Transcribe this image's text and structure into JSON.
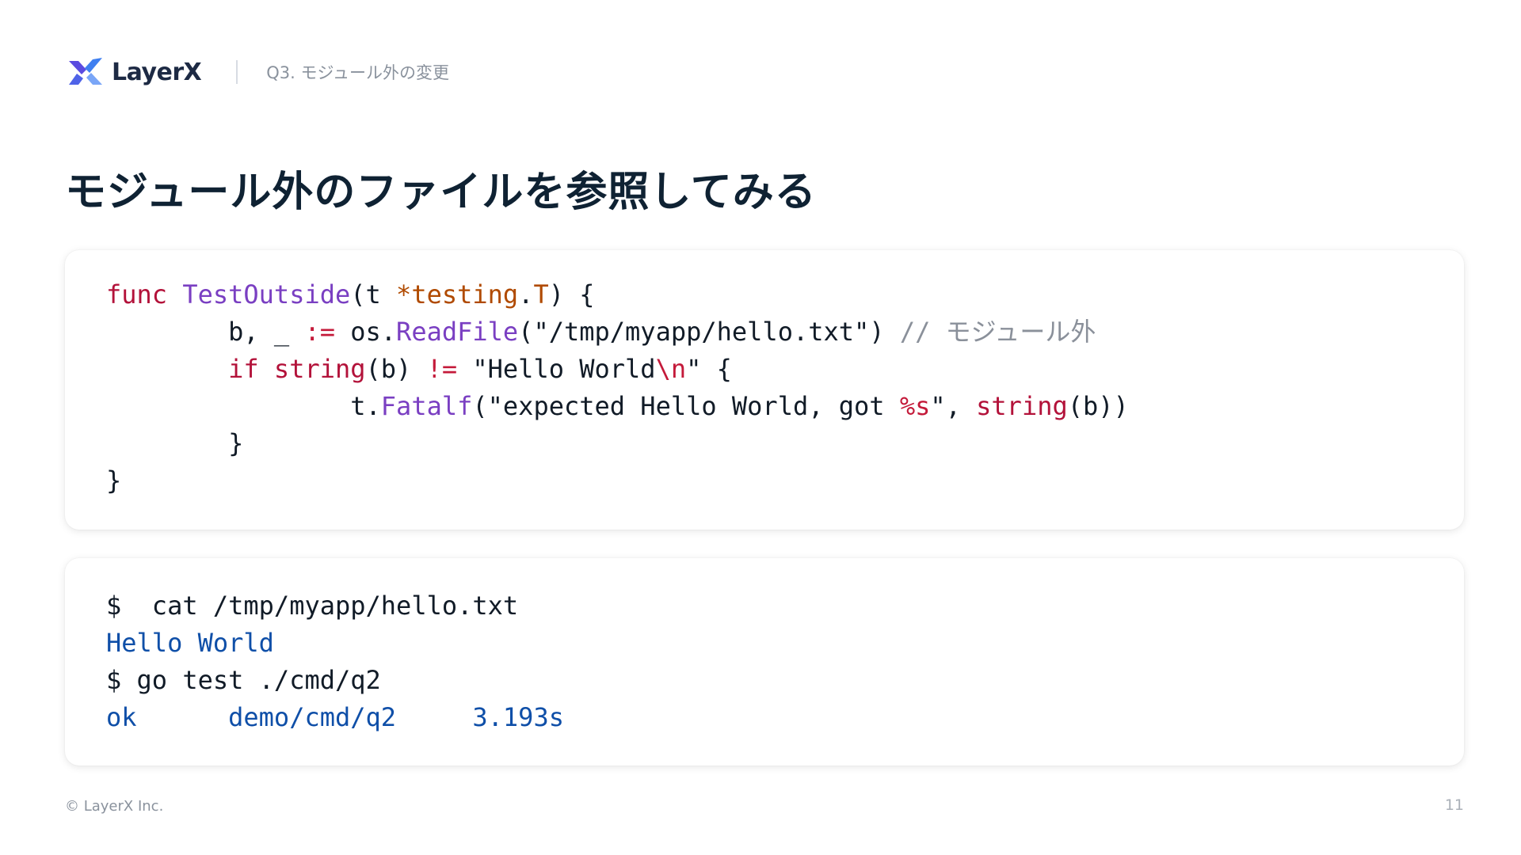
{
  "header": {
    "logo_text": "LayerX",
    "section": "Q3. モジュール外の変更"
  },
  "title": "モジュール外のファイルを参照してみる",
  "code": {
    "line1": {
      "kw": "func",
      "fn": "TestOutside",
      "open": "(t ",
      "ptr": "*testing",
      "dot": ".",
      "ty": "T",
      "close": ") {"
    },
    "line2": {
      "pre": "        b, _ ",
      "op": ":=",
      "mid": " os.",
      "fn": "ReadFile",
      "args": "(\"/tmp/myapp/hello.txt\") ",
      "cm": "// モジュール外"
    },
    "line3": {
      "kw": "if",
      "sp": " ",
      "fn": "string",
      "arg": "(b) ",
      "op": "!=",
      "str": " \"Hello World",
      "esc": "\\n",
      "tail": "\" {"
    },
    "line4": {
      "pre": "                t.",
      "fn": "Fatalf",
      "str": "(\"expected Hello World, got ",
      "fmt": "%s",
      "mid": "\", ",
      "fn2": "string",
      "tail": "(b))"
    },
    "line5": "        }",
    "line6": "}"
  },
  "terminal": {
    "line1": "$  cat /tmp/myapp/hello.txt",
    "line2": "Hello World",
    "line3": "$ go test ./cmd/q2",
    "line4": "ok      demo/cmd/q2     3.193s"
  },
  "footer": {
    "copyright": "© LayerX Inc.",
    "page_number": "11"
  },
  "colors": {
    "keyword": "#b3123a",
    "function": "#7a3fc2",
    "type": "#b04a00",
    "comment": "#8a909a",
    "output": "#0f4fa8",
    "title": "#0f2233"
  }
}
